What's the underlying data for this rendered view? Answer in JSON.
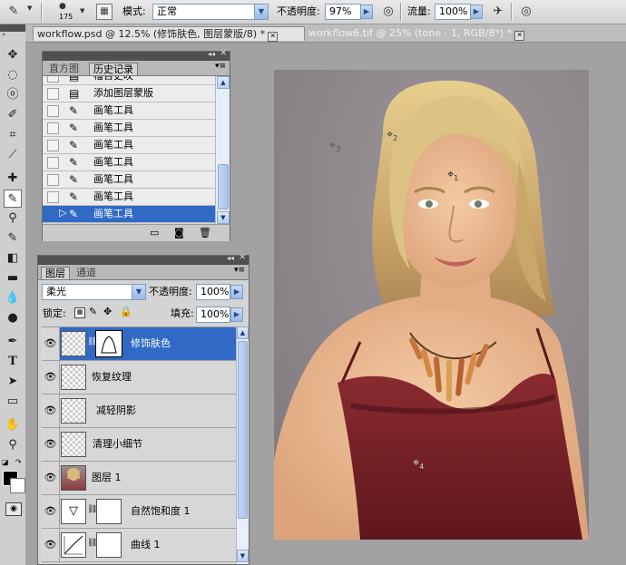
{
  "options_bar": {
    "brush_size": "175",
    "mode_label": "模式:",
    "mode_value": "正常",
    "opacity_label": "不透明度:",
    "opacity_value": "97%",
    "flow_label": "流量:",
    "flow_value": "100%"
  },
  "doc_tabs": [
    {
      "label": "workflow.psd @ 12.5% (修饰肤色, 图层蒙版/8) *"
    },
    {
      "label": "workflow6.tif @ 25% (tone - 1, RGB/8*) *"
    }
  ],
  "history_panel": {
    "tab_histogram": "直方图",
    "tab_history": "历史记录",
    "partial_item": "榴百史叹",
    "items": [
      {
        "label": "添加图层蒙版",
        "icon": "document-icon"
      },
      {
        "label": "画笔工具",
        "icon": "brush-icon"
      },
      {
        "label": "画笔工具",
        "icon": "brush-icon"
      },
      {
        "label": "画笔工具",
        "icon": "brush-icon"
      },
      {
        "label": "画笔工具",
        "icon": "brush-icon"
      },
      {
        "label": "画笔工具",
        "icon": "brush-icon"
      },
      {
        "label": "画笔工具",
        "icon": "brush-icon"
      },
      {
        "label": "画笔工具",
        "icon": "brush-icon"
      }
    ]
  },
  "layers_panel": {
    "tab_layers": "图层",
    "tab_channels": "通道",
    "blend_mode": "柔光",
    "opacity_label": "不透明度:",
    "opacity_value": "100%",
    "lock_label": "锁定:",
    "fill_label": "填充:",
    "fill_value": "100%",
    "layers": [
      {
        "name": "修饰肤色",
        "selected": true,
        "has_mask": true
      },
      {
        "name": "恢复纹理"
      },
      {
        "name": "减轻阴影"
      },
      {
        "name": "清理小细节"
      },
      {
        "name": "图层 1"
      },
      {
        "name": "自然饱和度 1"
      },
      {
        "name": "曲线 1"
      }
    ]
  },
  "color_samplers": [
    "1",
    "2",
    "3",
    "4"
  ],
  "colors": {
    "selection": "#316ac5",
    "panel_bg": "#d4d4d4",
    "canvas_bg": "#a2a2a2"
  }
}
